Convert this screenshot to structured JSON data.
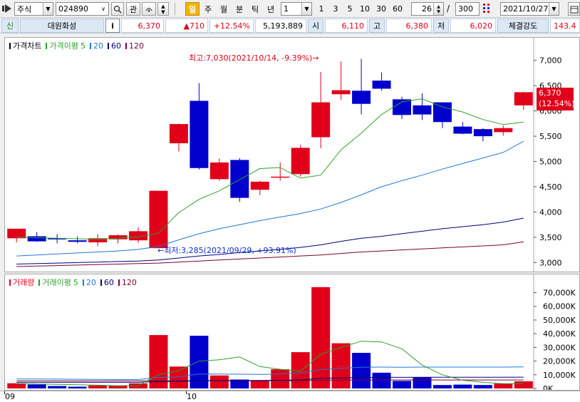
{
  "toolbar": {
    "market": "주식",
    "code": "024890",
    "btn_gwan": "관",
    "periods": [
      "일",
      "주",
      "월",
      "분",
      "틱",
      "년"
    ],
    "interval_value": "1",
    "interval_quick": [
      "1",
      "3",
      "5",
      "10",
      "30",
      "60"
    ],
    "count": "26",
    "slash": "/",
    "total": "300",
    "date": "2021/10/27"
  },
  "quote": {
    "tag": "신",
    "name": "대원화성",
    "info": "i",
    "price": "6,370",
    "change": "▲710",
    "change_pct": "+12.54%",
    "volume": "5,193,889",
    "open_label": "시",
    "open": "6,110",
    "high_label": "고",
    "high": "6,380",
    "low_label": "저",
    "low": "6,020",
    "strength_label": "체결강도",
    "strength": "143.4"
  },
  "price_legend": {
    "title": "가격차트",
    "ma_title": "가격이평",
    "periods": [
      "5",
      "20",
      "60",
      "120"
    ]
  },
  "volume_legend": {
    "title": "거래량",
    "ma_title": "거래이평",
    "periods": [
      "5",
      "20",
      "60",
      "120"
    ]
  },
  "annotations": {
    "high": "최고:7,030(2021/10/14, -9.39%)→",
    "low": "←최저:3,285(2021/09/29, +93.91%)",
    "last_price": "6,370",
    "last_pct": "(12.54%)"
  },
  "price_axis": [
    "7,000",
    "6,500",
    "6,000",
    "5,500",
    "5,000",
    "4,500",
    "4,000",
    "3,500",
    "3,000"
  ],
  "volume_axis": [
    "70,000K",
    "60,000K",
    "50,000K",
    "40,000K",
    "30,000K",
    "20,000K",
    "10,000K",
    "0K"
  ],
  "date_axis": [
    "09",
    "10"
  ],
  "colors": {
    "up": "#e0001a",
    "down": "#0000cd",
    "ma5": "#2ca02c",
    "ma20": "#1f77d4",
    "ma60": "#00007a",
    "ma120": "#7a0033"
  },
  "chart_data": {
    "type": "candlestick",
    "candles": [
      {
        "open": 3480,
        "high": 3670,
        "low": 3400,
        "close": 3670
      },
      {
        "open": 3520,
        "high": 3600,
        "low": 3410,
        "close": 3420
      },
      {
        "open": 3480,
        "high": 3560,
        "low": 3380,
        "close": 3470
      },
      {
        "open": 3440,
        "high": 3520,
        "low": 3380,
        "close": 3410
      },
      {
        "open": 3400,
        "high": 3560,
        "low": 3320,
        "close": 3480
      },
      {
        "open": 3460,
        "high": 3560,
        "low": 3380,
        "close": 3540
      },
      {
        "open": 3440,
        "high": 3700,
        "low": 3390,
        "close": 3620
      },
      {
        "open": 3285,
        "high": 4420,
        "low": 3285,
        "close": 4420
      },
      {
        "open": 5360,
        "high": 5750,
        "low": 5200,
        "close": 5740
      },
      {
        "open": 6200,
        "high": 6550,
        "low": 4840,
        "close": 4870
      },
      {
        "open": 4650,
        "high": 5060,
        "low": 4620,
        "close": 4980
      },
      {
        "open": 5030,
        "high": 5070,
        "low": 4200,
        "close": 4280
      },
      {
        "open": 4440,
        "high": 4620,
        "low": 4330,
        "close": 4600
      },
      {
        "open": 4680,
        "high": 4980,
        "low": 4620,
        "close": 4700
      },
      {
        "open": 4750,
        "high": 5330,
        "low": 4700,
        "close": 5270
      },
      {
        "open": 5480,
        "high": 6770,
        "low": 5260,
        "close": 6170
      },
      {
        "open": 6330,
        "high": 6980,
        "low": 6220,
        "close": 6410
      },
      {
        "open": 6400,
        "high": 7030,
        "low": 5930,
        "close": 6140
      },
      {
        "open": 6600,
        "high": 6760,
        "low": 6400,
        "close": 6440
      },
      {
        "open": 6230,
        "high": 6280,
        "low": 5840,
        "close": 5920
      },
      {
        "open": 6110,
        "high": 6350,
        "low": 5820,
        "close": 5930
      },
      {
        "open": 6170,
        "high": 6170,
        "low": 5660,
        "close": 5780
      },
      {
        "open": 5690,
        "high": 5780,
        "low": 5540,
        "close": 5550
      },
      {
        "open": 5640,
        "high": 5660,
        "low": 5400,
        "close": 5500
      },
      {
        "open": 5580,
        "high": 5710,
        "low": 5510,
        "close": 5660
      },
      {
        "open": 6110,
        "high": 6380,
        "low": 6020,
        "close": 6370
      }
    ],
    "ma5": [
      3500,
      3490,
      3480,
      3470,
      3460,
      3480,
      3510,
      3580,
      3990,
      4250,
      4420,
      4640,
      4860,
      4880,
      4670,
      4730,
      5230,
      5560,
      5930,
      6180,
      6240,
      6080,
      5980,
      5830,
      5730,
      5780
    ],
    "ma20": [
      3130,
      3150,
      3170,
      3190,
      3210,
      3230,
      3260,
      3320,
      3450,
      3570,
      3670,
      3750,
      3830,
      3900,
      3970,
      4060,
      4190,
      4340,
      4500,
      4620,
      4730,
      4850,
      4960,
      5070,
      5180,
      5400
    ],
    "ma60": [
      2970,
      2980,
      2990,
      3000,
      3010,
      3020,
      3030,
      3050,
      3090,
      3130,
      3160,
      3200,
      3230,
      3260,
      3300,
      3350,
      3420,
      3480,
      3520,
      3570,
      3620,
      3670,
      3710,
      3750,
      3800,
      3880
    ],
    "ma120": [
      2920,
      2930,
      2940,
      2950,
      2960,
      2970,
      2980,
      2990,
      3010,
      3030,
      3050,
      3070,
      3090,
      3110,
      3130,
      3150,
      3180,
      3210,
      3230,
      3250,
      3270,
      3290,
      3310,
      3330,
      3350,
      3410
    ],
    "volume": [
      3800,
      2900,
      1800,
      1300,
      2200,
      2000,
      3700,
      39000,
      16000,
      38500,
      9500,
      6500,
      6000,
      14000,
      26500,
      74000,
      33000,
      26000,
      11500,
      5500,
      8000,
      2500,
      2800,
      2500,
      3500,
      5200
    ],
    "vol_ma5": [
      3500,
      3300,
      3000,
      2700,
      2400,
      2000,
      2200,
      10000,
      13000,
      20000,
      21000,
      23000,
      16000,
      14000,
      12500,
      25000,
      30000,
      34500,
      34000,
      29000,
      17000,
      10000,
      6000,
      4500,
      3500,
      3500
    ],
    "vol_ma20": [
      7000,
      6900,
      6800,
      6700,
      6600,
      6500,
      6500,
      8000,
      8500,
      10500,
      10500,
      10400,
      10300,
      10500,
      11300,
      13800,
      14800,
      15500,
      15600,
      15500,
      15600,
      15600,
      15600,
      15600,
      15600,
      15700
    ],
    "vol_ma60": [
      4500,
      4500,
      4500,
      4500,
      4500,
      4500,
      4500,
      5000,
      5200,
      5700,
      5800,
      5800,
      5900,
      6000,
      6300,
      7300,
      7700,
      8000,
      8100,
      8100,
      8200,
      8200,
      8200,
      8200,
      8200,
      8300
    ],
    "vol_ma120": [
      5500,
      5500,
      5500,
      5500,
      5500,
      5500,
      5500,
      5500,
      5500,
      5600,
      5600,
      5600,
      5600,
      5700,
      5700,
      6000,
      6100,
      6200,
      6200,
      6200,
      6200,
      6200,
      6200,
      6200,
      6200,
      6200
    ],
    "price_ylim": [
      2850,
      7250
    ],
    "volume_ylim": [
      0,
      76000
    ],
    "xlabel": "",
    "ylabel": ""
  }
}
